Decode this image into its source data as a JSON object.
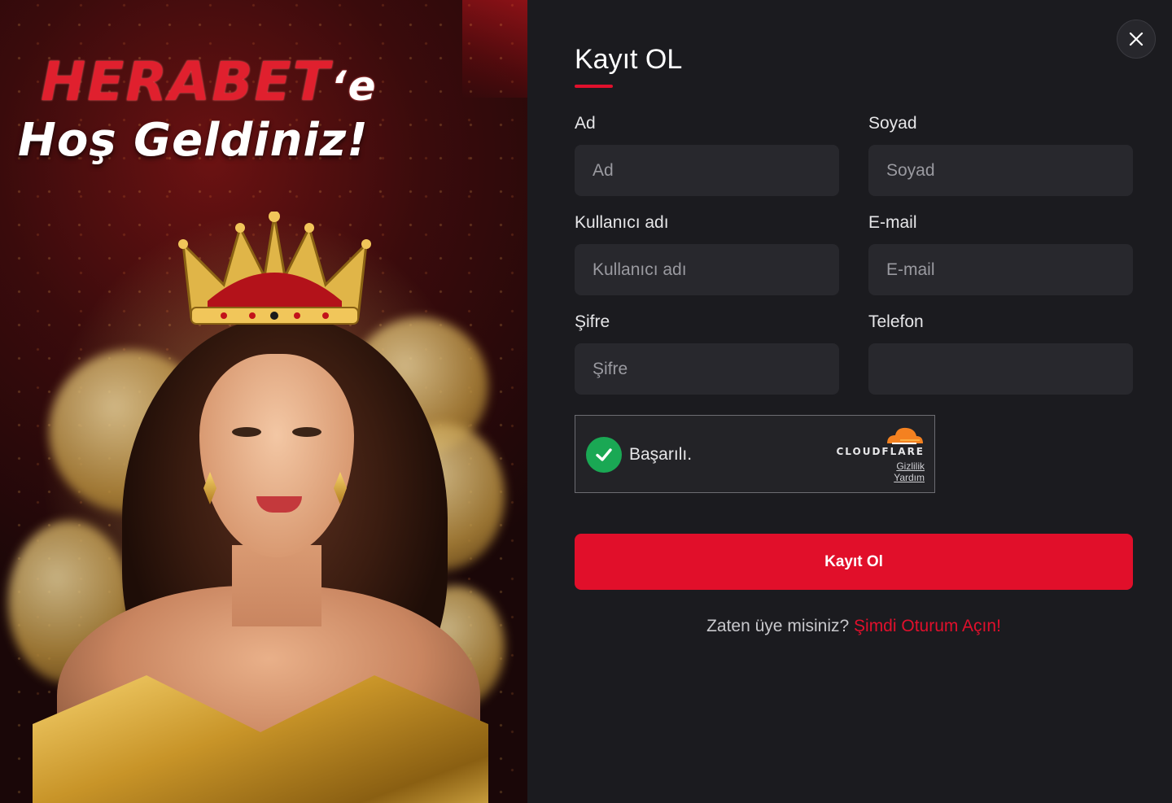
{
  "promo": {
    "brand": "HERABET",
    "brand_suffix": "‘e",
    "welcome": "Hoş Geldiniz!"
  },
  "form": {
    "title": "Kayıt OL",
    "fields": {
      "first_name": {
        "label": "Ad",
        "placeholder": "Ad"
      },
      "last_name": {
        "label": "Soyad",
        "placeholder": "Soyad"
      },
      "username": {
        "label": "Kullanıcı adı",
        "placeholder": "Kullanıcı adı"
      },
      "email": {
        "label": "E-mail",
        "placeholder": "E-mail"
      },
      "password": {
        "label": "Şifre",
        "placeholder": "Şifre"
      },
      "phone": {
        "label": "Telefon",
        "placeholder": ""
      }
    },
    "captcha": {
      "status": "Başarılı.",
      "provider": "CLOUDFLARE",
      "privacy_link": "Gizlilik",
      "help_link": "Yardım"
    },
    "submit_label": "Kayıt Ol",
    "login_prompt": "Zaten üye misiniz?",
    "login_link": "Şimdi Oturum Açın!"
  },
  "colors": {
    "accent": "#e10f2a",
    "panel_bg": "#1b1b1f",
    "input_bg": "#28282d",
    "success": "#1aa854",
    "cloudflare_orange": "#f48120"
  },
  "icons": {
    "close": "close-icon",
    "captcha_check": "checkmark-icon",
    "cloudflare": "cloudflare-logo-icon"
  }
}
